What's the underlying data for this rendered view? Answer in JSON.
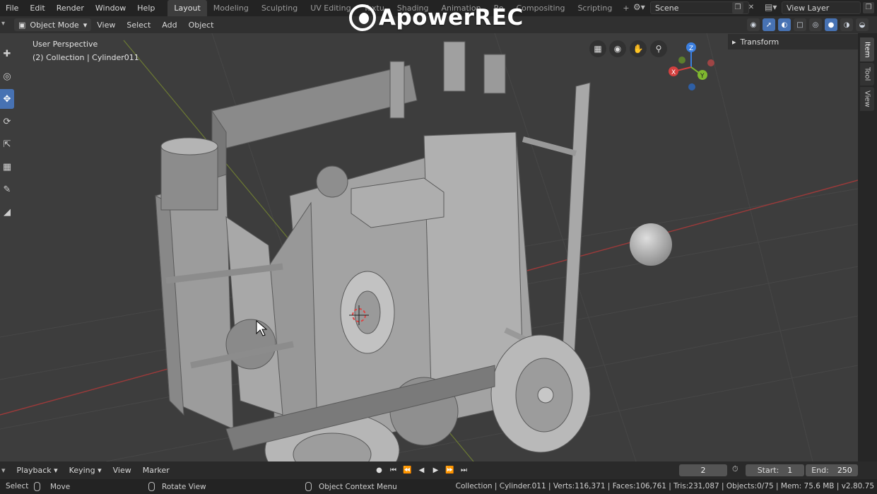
{
  "watermark": "ApowerREC",
  "menu": [
    "File",
    "Edit",
    "Render",
    "Window",
    "Help"
  ],
  "workspaces": [
    "Layout",
    "Modeling",
    "Sculpting",
    "UV Editing",
    "Textu",
    "Shading",
    "Animation",
    "Re",
    "Compositing",
    "Scripting"
  ],
  "workspace_active": "Layout",
  "workspace_add": "+",
  "scene": "Scene",
  "view_layer": "View Layer",
  "viewport_header": {
    "mode": "Object Mode",
    "menus": [
      "View",
      "Select",
      "Add",
      "Object"
    ]
  },
  "viewport": {
    "perspective_label": "User Perspective",
    "collection_label": "(2) Collection | Cylinder011",
    "transform_panel": "Transform",
    "gizmo_axes": [
      "X",
      "Y",
      "Z"
    ],
    "side_tabs": [
      "Item",
      "Tool",
      "View"
    ]
  },
  "timeline": {
    "menus": [
      "Playback",
      "Keying",
      "View",
      "Marker"
    ],
    "current_frame": "2",
    "start_label": "Start:",
    "start_value": "1",
    "end_label": "End:",
    "end_value": "250"
  },
  "status": {
    "select": "Select",
    "move": "Move",
    "rotate": "Rotate View",
    "context_menu": "Object Context Menu",
    "stats": "Collection | Cylinder.011 | Verts:116,371 | Faces:106,761 | Tris:231,087 | Objects:0/75 | Mem: 75.6 MB | v2.80.75"
  },
  "colors": {
    "accent": "#4772b3",
    "x_axis": "#d3403f",
    "y_axis": "#7fb82f",
    "z_axis": "#3b7fe0"
  }
}
